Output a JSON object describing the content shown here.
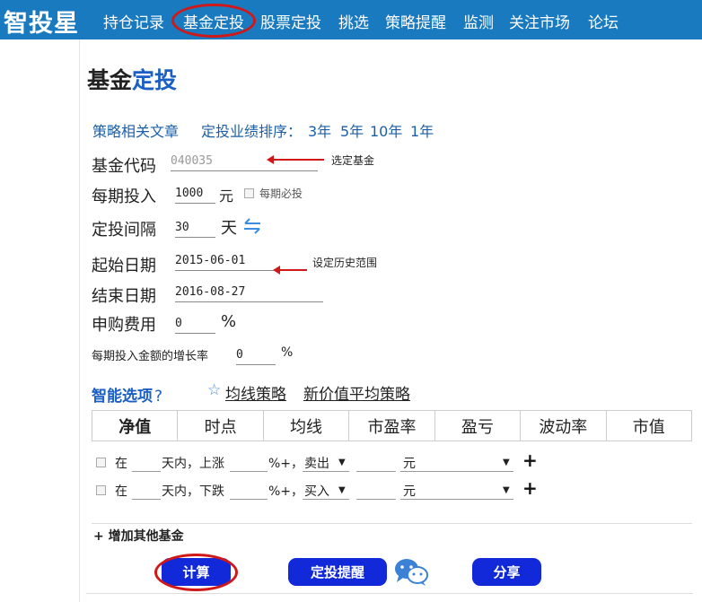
{
  "app": {
    "logo": "智投星"
  },
  "nav": {
    "items": [
      "持仓记录",
      "基金定投",
      "股票定投",
      "挑选",
      "策略提醒",
      "监测",
      "关注市场",
      "论坛"
    ],
    "active_index": 1
  },
  "page": {
    "title_part1": "基金",
    "title_part2": "定投"
  },
  "links": {
    "articles": "策略相关文章",
    "ranking_label": "定投业绩排序：",
    "ranking_options": [
      "3年",
      "5年",
      "10年",
      "1年"
    ]
  },
  "form": {
    "fund_code": {
      "label": "基金代码",
      "placeholder": "040035",
      "annotation": "选定基金"
    },
    "period_invest": {
      "label": "每期投入",
      "value": "1000",
      "unit": "元",
      "checkbox_label": "每期必投"
    },
    "interval": {
      "label": "定投间隔",
      "value": "30",
      "unit": "天"
    },
    "start_date": {
      "label": "起始日期",
      "value": "2015-06-01",
      "annotation": "设定历史范围"
    },
    "end_date": {
      "label": "结束日期",
      "value": "2016-08-27"
    },
    "fee": {
      "label": "申购费用",
      "value": "0",
      "unit": "%"
    },
    "growth_rate": {
      "label": "每期投入金额的增长率",
      "value": "0",
      "unit": "%"
    }
  },
  "smart": {
    "title": "智能选项",
    "help": "?",
    "star": "☆",
    "ma_strategy": "均线策略",
    "value_avg_strategy": "新价值平均策略"
  },
  "tabs": [
    "净值",
    "时点",
    "均线",
    "市盈率",
    "盈亏",
    "波动率",
    "市值"
  ],
  "conditions": [
    {
      "prefix": "在",
      "days_text": "天内，上涨",
      "percent_text": "%+，",
      "action": "卖出",
      "unit": "元",
      "plus": "+"
    },
    {
      "prefix": "在",
      "days_text": "天内，下跌",
      "percent_text": "%+，",
      "action": "买入",
      "unit": "元",
      "plus": "+"
    }
  ],
  "add_fund": "+ 增加其他基金",
  "buttons": {
    "calculate": "计算",
    "remind": "定投提醒",
    "share": "分享"
  },
  "colors": {
    "topbar": "#1a7ac0",
    "button": "#1129d8",
    "accent": "#1b5fc4",
    "annotation": "#d01818"
  },
  "icons": {
    "swap": "swap-arrows-icon",
    "wechat": "wechat-icon"
  }
}
